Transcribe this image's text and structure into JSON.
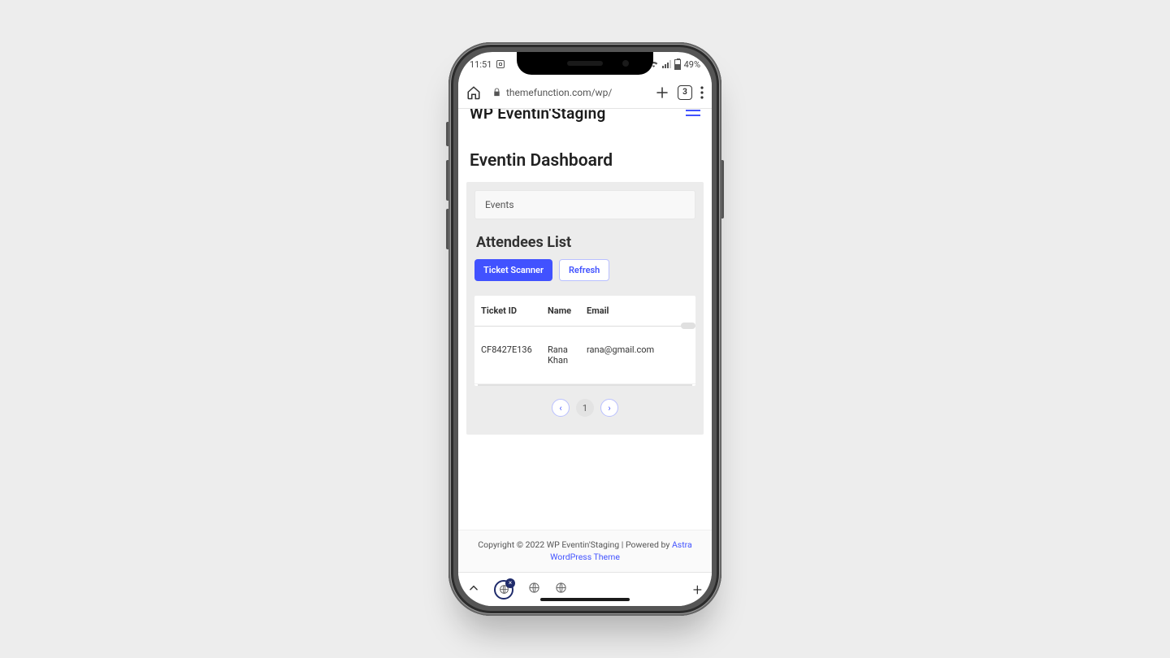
{
  "status": {
    "time": "11:51",
    "battery_pct": "49%",
    "notif_count": "1"
  },
  "browser": {
    "url_display": "themefunction.com/wp/",
    "tab_count": "3"
  },
  "site": {
    "title": "WP Eventin'Staging",
    "dashboard_title": "Eventin Dashboard",
    "events_label": "Events",
    "attendees_title": "Attendees List",
    "ticket_scanner_label": "Ticket Scanner",
    "refresh_label": "Refresh"
  },
  "table": {
    "cols": {
      "ticket": "Ticket ID",
      "name": "Name",
      "email": "Email"
    },
    "rows": [
      {
        "ticket": "CF8427E136",
        "name": "Rana Khan",
        "email": "rana@gmail.com"
      }
    ]
  },
  "pager": {
    "current": "1"
  },
  "footer": {
    "text": "Copyright © 2022 WP Eventin'Staging | Powered by ",
    "link": "Astra WordPress Theme"
  }
}
